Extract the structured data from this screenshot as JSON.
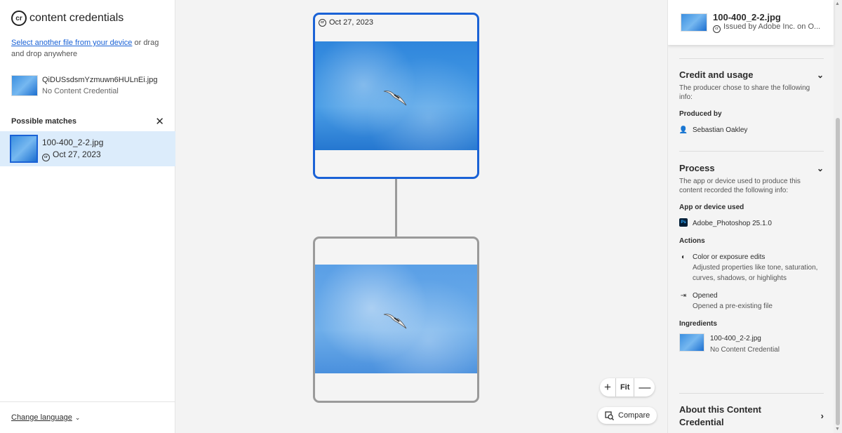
{
  "app": {
    "logo_text": "content credentials",
    "logo_glyph": "cr"
  },
  "sidebar": {
    "select_link": "Select another file from your device",
    "select_rest": " or drag and drop anywhere",
    "file": {
      "name": "QiDUSsdsmYzmuwn6HULnEi.jpg",
      "status": "No Content Credential"
    },
    "matches_label": "Possible matches",
    "close_glyph": "✕",
    "match": {
      "name": "100-400_2-2.jpg",
      "date": "Oct 27, 2023"
    },
    "change_language": "Change language"
  },
  "canvas": {
    "top_card_date": "Oct 27, 2023",
    "zoom": {
      "plus": "+",
      "fit": "Fit",
      "minus": "—"
    },
    "compare_label": "Compare"
  },
  "panel": {
    "header": {
      "title": "100-400_2-2.jpg",
      "issued": "Issued by Adobe Inc. on O..."
    },
    "credit": {
      "title": "Credit and usage",
      "desc": "The producer chose to share the following info:",
      "produced_by_label": "Produced by",
      "producer": "Sebastian Oakley"
    },
    "process": {
      "title": "Process",
      "desc": "The app or device used to produce this content recorded the following info:",
      "app_label": "App or device used",
      "app": "Adobe_Photoshop 25.1.0",
      "actions_label": "Actions",
      "action1_title": "Color or exposure edits",
      "action1_desc": "Adjusted properties like tone, saturation, curves, shadows, or highlights",
      "action2_title": "Opened",
      "action2_desc": "Opened a pre-existing file",
      "ingredients_label": "Ingredients",
      "ingredient_name": "100-400_2-2.jpg",
      "ingredient_status": "No Content Credential"
    },
    "about": "About this Content Credential"
  },
  "colors": {
    "accent": "#1a62d6",
    "selected_bg": "#dcecfb"
  }
}
